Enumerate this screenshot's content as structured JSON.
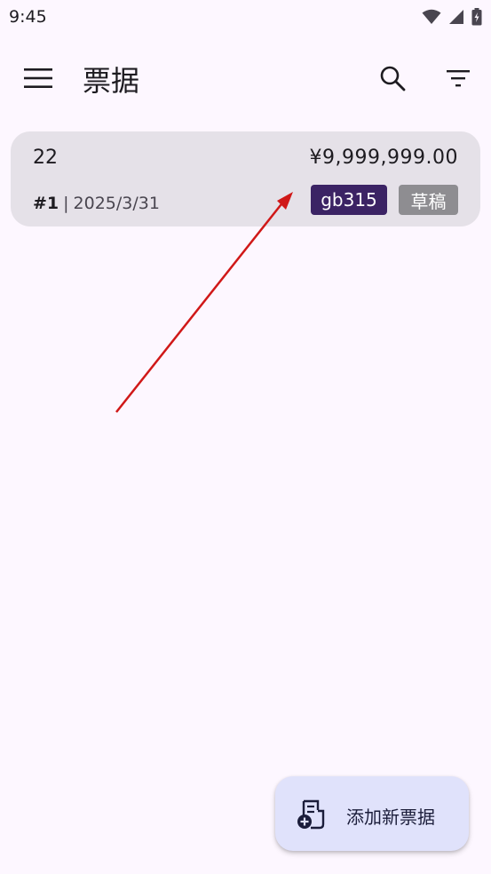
{
  "status_bar": {
    "time": "9:45",
    "icons": [
      "wifi-icon",
      "signal-icon",
      "battery-icon"
    ]
  },
  "app_bar": {
    "title": "票据",
    "icons": [
      "menu-icon",
      "search-icon",
      "filter-icon"
    ]
  },
  "invoices": [
    {
      "name": "22",
      "amount": "¥9,999,999.00",
      "number": "#1",
      "separator": "|",
      "date": "2025/3/31",
      "tag": "gb315",
      "status": "草稿"
    }
  ],
  "fab": {
    "label": "添加新票据",
    "icon": "add-receipt-icon"
  },
  "colors": {
    "background": "#fdf7ff",
    "card": "#e5e1e8",
    "tag_chip": "#3b2364",
    "status_chip": "#8e8d91",
    "fab": "#e0e2fb",
    "annotation_arrow": "#d01818"
  }
}
